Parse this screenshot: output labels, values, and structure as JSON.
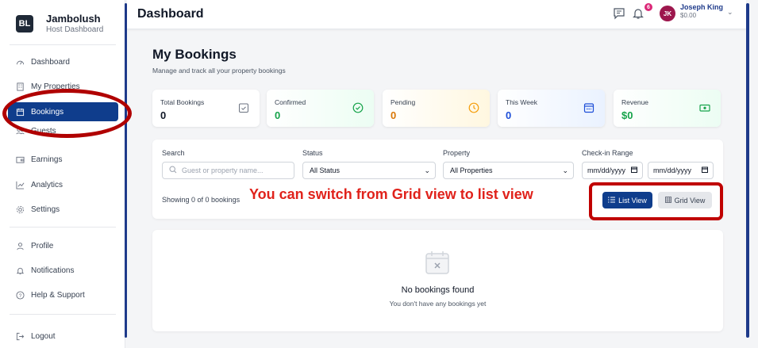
{
  "brand": {
    "logo": "BL",
    "title": "Jambolush",
    "subtitle": "Host Dashboard"
  },
  "sidebar": {
    "items": [
      {
        "label": "Dashboard",
        "icon": "gauge-icon"
      },
      {
        "label": "My Properties",
        "icon": "building-icon"
      },
      {
        "label": "Bookings",
        "icon": "calendar-icon",
        "active": true
      },
      {
        "label": "Guests",
        "icon": "users-icon"
      },
      {
        "label": "Earnings",
        "icon": "wallet-icon"
      },
      {
        "label": "Analytics",
        "icon": "chart-icon"
      },
      {
        "label": "Settings",
        "icon": "gear-icon"
      }
    ],
    "account_items": [
      {
        "label": "Profile",
        "icon": "user-icon"
      },
      {
        "label": "Notifications",
        "icon": "bell-icon"
      },
      {
        "label": "Help & Support",
        "icon": "help-icon"
      }
    ],
    "logout": {
      "label": "Logout",
      "icon": "logout-icon"
    }
  },
  "header": {
    "title": "Dashboard",
    "notification_count": "6",
    "user": {
      "initials": "JK",
      "name": "Joseph King",
      "balance": "$0.00"
    }
  },
  "page": {
    "title": "My Bookings",
    "subtitle": "Manage and track all your property bookings"
  },
  "stats": [
    {
      "label": "Total Bookings",
      "value": "0",
      "color": "#111827",
      "icon": "calendar-check-icon"
    },
    {
      "label": "Confirmed",
      "value": "0",
      "color": "#16a34a",
      "icon": "check-circle-icon"
    },
    {
      "label": "Pending",
      "value": "0",
      "color": "#d97706",
      "icon": "clock-icon"
    },
    {
      "label": "This Week",
      "value": "0",
      "color": "#1d4ed8",
      "icon": "calendar-week-icon"
    },
    {
      "label": "Revenue",
      "value": "$0",
      "color": "#16a34a",
      "icon": "money-icon"
    }
  ],
  "filters": {
    "search": {
      "label": "Search",
      "placeholder": "Guest or property name..."
    },
    "status": {
      "label": "Status",
      "value": "All Status"
    },
    "property": {
      "label": "Property",
      "value": "All Properties"
    },
    "checkin": {
      "label": "Check-in Range",
      "from": "mm/dd/yyyy",
      "to": "mm/dd/yyyy"
    },
    "showing": "Showing 0 of 0 bookings",
    "list_view": "List View",
    "grid_view": "Grid View"
  },
  "annotation": "You can switch from Grid view to list view",
  "empty": {
    "title": "No bookings found",
    "subtitle": "You don't have any bookings yet"
  },
  "colors": {
    "primary": "#0f3d8c",
    "annotation": "#e0221b",
    "highlight": "#c00000"
  }
}
